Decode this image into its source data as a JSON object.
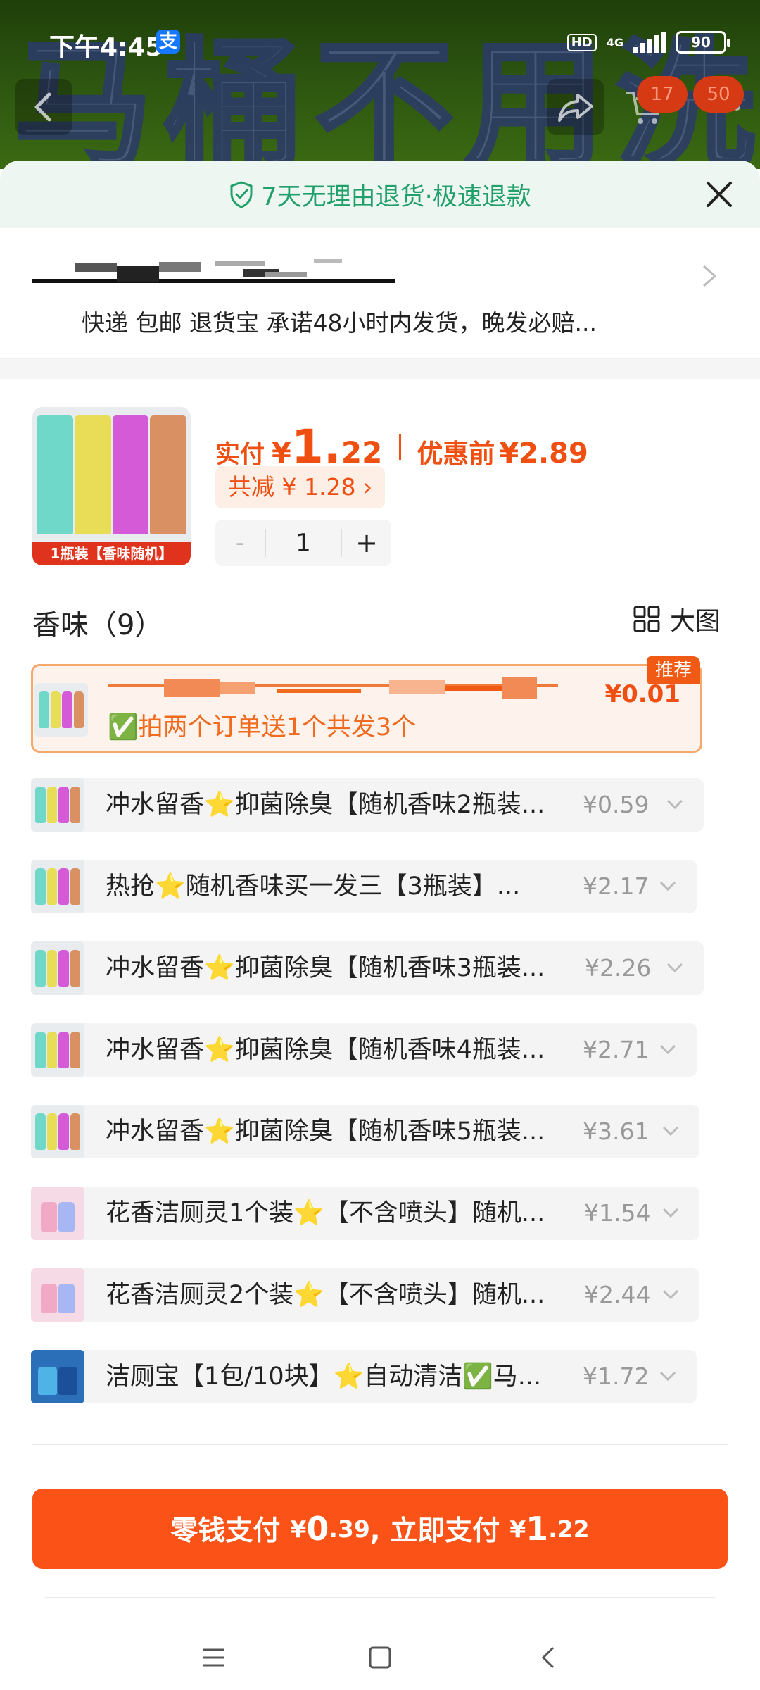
{
  "status_bar": {
    "time": "下午4:45",
    "alipay_badge": "支",
    "hd": "HD",
    "network": "4G",
    "battery": "90"
  },
  "banner": {
    "text": "马桶不用洗"
  },
  "header": {
    "cart_count": "17",
    "message_count": "50"
  },
  "return_policy": {
    "text": "7天无理由退货·极速退款"
  },
  "delivery": {
    "text": "快递 包邮 退货宝 承诺48小时内发货，晚发必赔..."
  },
  "product": {
    "thumb_label": "1瓶装【香味随机】",
    "paid_label": "实付",
    "currency": "¥",
    "paid_int": "1.",
    "paid_dec": "22",
    "pre_label": "优惠前",
    "pre_price": "¥2.89",
    "discount": "共减 ¥ 1.28 ›",
    "minus": "-",
    "quantity": "1",
    "plus": "+"
  },
  "flavor": {
    "title": "香味（9）",
    "toggle_label": "大图"
  },
  "options": {
    "featured": {
      "tag": "推荐",
      "desc": "✅拍两个订单送1个共发3个",
      "price": "¥0.01"
    },
    "items": [
      {
        "name": "冲水留香⭐抑菌除臭【随机香味2瓶装...",
        "price": "¥0.59"
      },
      {
        "name": "热抢⭐随机香味买一发三【3瓶装】...",
        "price": "¥2.17"
      },
      {
        "name": "冲水留香⭐抑菌除臭【随机香味3瓶装...",
        "price": "¥2.26"
      },
      {
        "name": "冲水留香⭐抑菌除臭【随机香味4瓶装...",
        "price": "¥2.71"
      },
      {
        "name": "冲水留香⭐抑菌除臭【随机香味5瓶装...",
        "price": "¥3.61"
      },
      {
        "name": "花香洁厕灵1个装⭐【不含喷头】随机...",
        "price": "¥1.54"
      },
      {
        "name": "花香洁厕灵2个装⭐【不含喷头】随机...",
        "price": "¥2.44"
      },
      {
        "name": "洁厕宝【1包/10块】⭐自动清洁✅马...",
        "price": "¥1.72"
      }
    ]
  },
  "pay": {
    "part1": "零钱支付",
    "cur1": "¥",
    "amt1_big": "0",
    "amt1_small": ".39",
    "part2": ", 立即支付",
    "cur2": "¥",
    "amt2_big": "1",
    "amt2_small": ".22"
  },
  "colors": {
    "accent": "#fb5317",
    "price_orange": "#f04f12",
    "return_green": "#21a06b"
  },
  "icons": {
    "back": "chevron-left-icon",
    "share": "share-icon",
    "cart": "cart-icon",
    "more": "more-icon",
    "shield": "shield-check-icon",
    "close": "close-icon",
    "grid": "grid-icon",
    "chevron_down": "chevron-down-icon",
    "menu": "menu-icon",
    "home": "home-square-icon",
    "sys_back": "back-icon"
  }
}
